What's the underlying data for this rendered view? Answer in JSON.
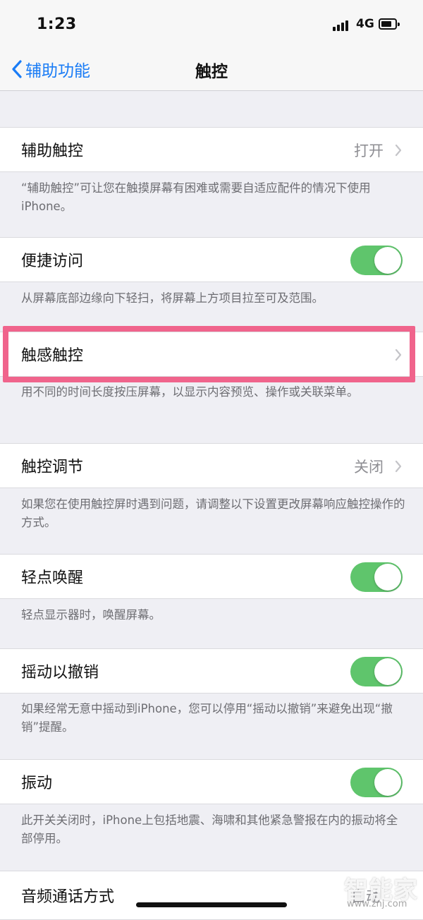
{
  "status_bar": {
    "time": "1:23",
    "network": "4G"
  },
  "nav": {
    "back_label": "辅助功能",
    "title": "触控"
  },
  "sections": [
    {
      "label": "辅助触控",
      "value": "打开",
      "footer": "“辅助触控”可让您在触摸屏幕有困难或需要自适应配件的情况下使用iPhone。"
    },
    {
      "label": "便捷访问",
      "toggle": true,
      "footer": "从屏幕底部边缘向下轻扫，将屏幕上方项目拉至可及范围。"
    },
    {
      "label": "触感触控",
      "footer": "用不同的时间长度按压屏幕，以显示内容预览、操作或关联菜单。"
    },
    {
      "label": "触控调节",
      "value": "关闭",
      "footer": "如果您在使用触控屏时遇到问题，请调整以下设置更改屏幕响应触控操作的方式。"
    },
    {
      "label": "轻点唤醒",
      "toggle": true,
      "footer": "轻点显示器时，唤醒屏幕。"
    },
    {
      "label": "摇动以撤销",
      "toggle": true,
      "footer": "如果经常无意中摇动到iPhone，您可以停用“摇动以撤销”来避免出现“撤销”提醒。"
    },
    {
      "label": "振动",
      "toggle": true,
      "footer": "此开关关闭时，iPhone上包括地震、海啸和其他紧急警报在内的振动将全部停用。"
    },
    {
      "label": "音频通话方式",
      "value": "自动"
    }
  ],
  "watermark": {
    "main": "智能家",
    "url": "www.znj.com"
  },
  "colors": {
    "accent": "#1a7cf6",
    "toggle_on": "#5fc56c",
    "highlight": "#f0648c",
    "background": "#efeff4"
  }
}
